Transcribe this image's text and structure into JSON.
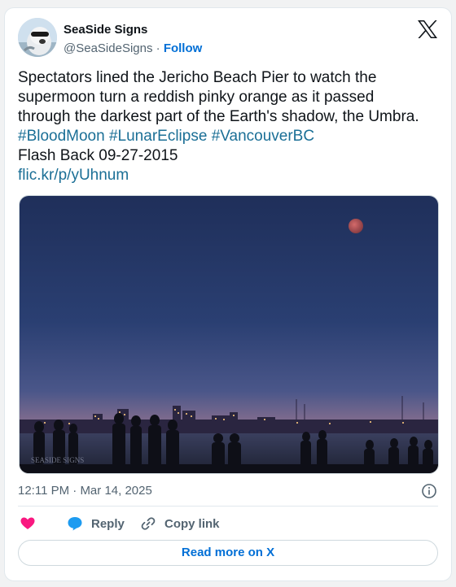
{
  "author": {
    "display_name": "SeaSide Signs",
    "handle": "@SeaSideSigns",
    "separator": " · ",
    "follow_label": "Follow",
    "avatar_icon": "seal-avatar"
  },
  "tweet": {
    "text_plain": "Spectators lined the Jericho Beach Pier to watch the supermoon turn a reddish pinky orange as it passed through the darkest part of the Earth's shadow, the Umbra. ",
    "hashtags": [
      "#BloodMoon",
      "#LunarEclipse",
      "#VancouverBC"
    ],
    "line2": "Flash Back 09-27-2015",
    "link": "flic.kr/p/yUhnum"
  },
  "photo": {
    "watermark": "SEASIDE SIGNS"
  },
  "meta": {
    "time": "12:11 PM",
    "separator": " · ",
    "date": "Mar 14, 2025"
  },
  "actions": {
    "like_icon": "heart-icon",
    "reply_label": "Reply",
    "copy_label": "Copy link"
  },
  "read_more_label": "Read more on X",
  "colors": {
    "link": "#1b6f96",
    "accent": "#006fd6",
    "heart": "#f91880",
    "reply_bubble": "#1d9bf0"
  }
}
